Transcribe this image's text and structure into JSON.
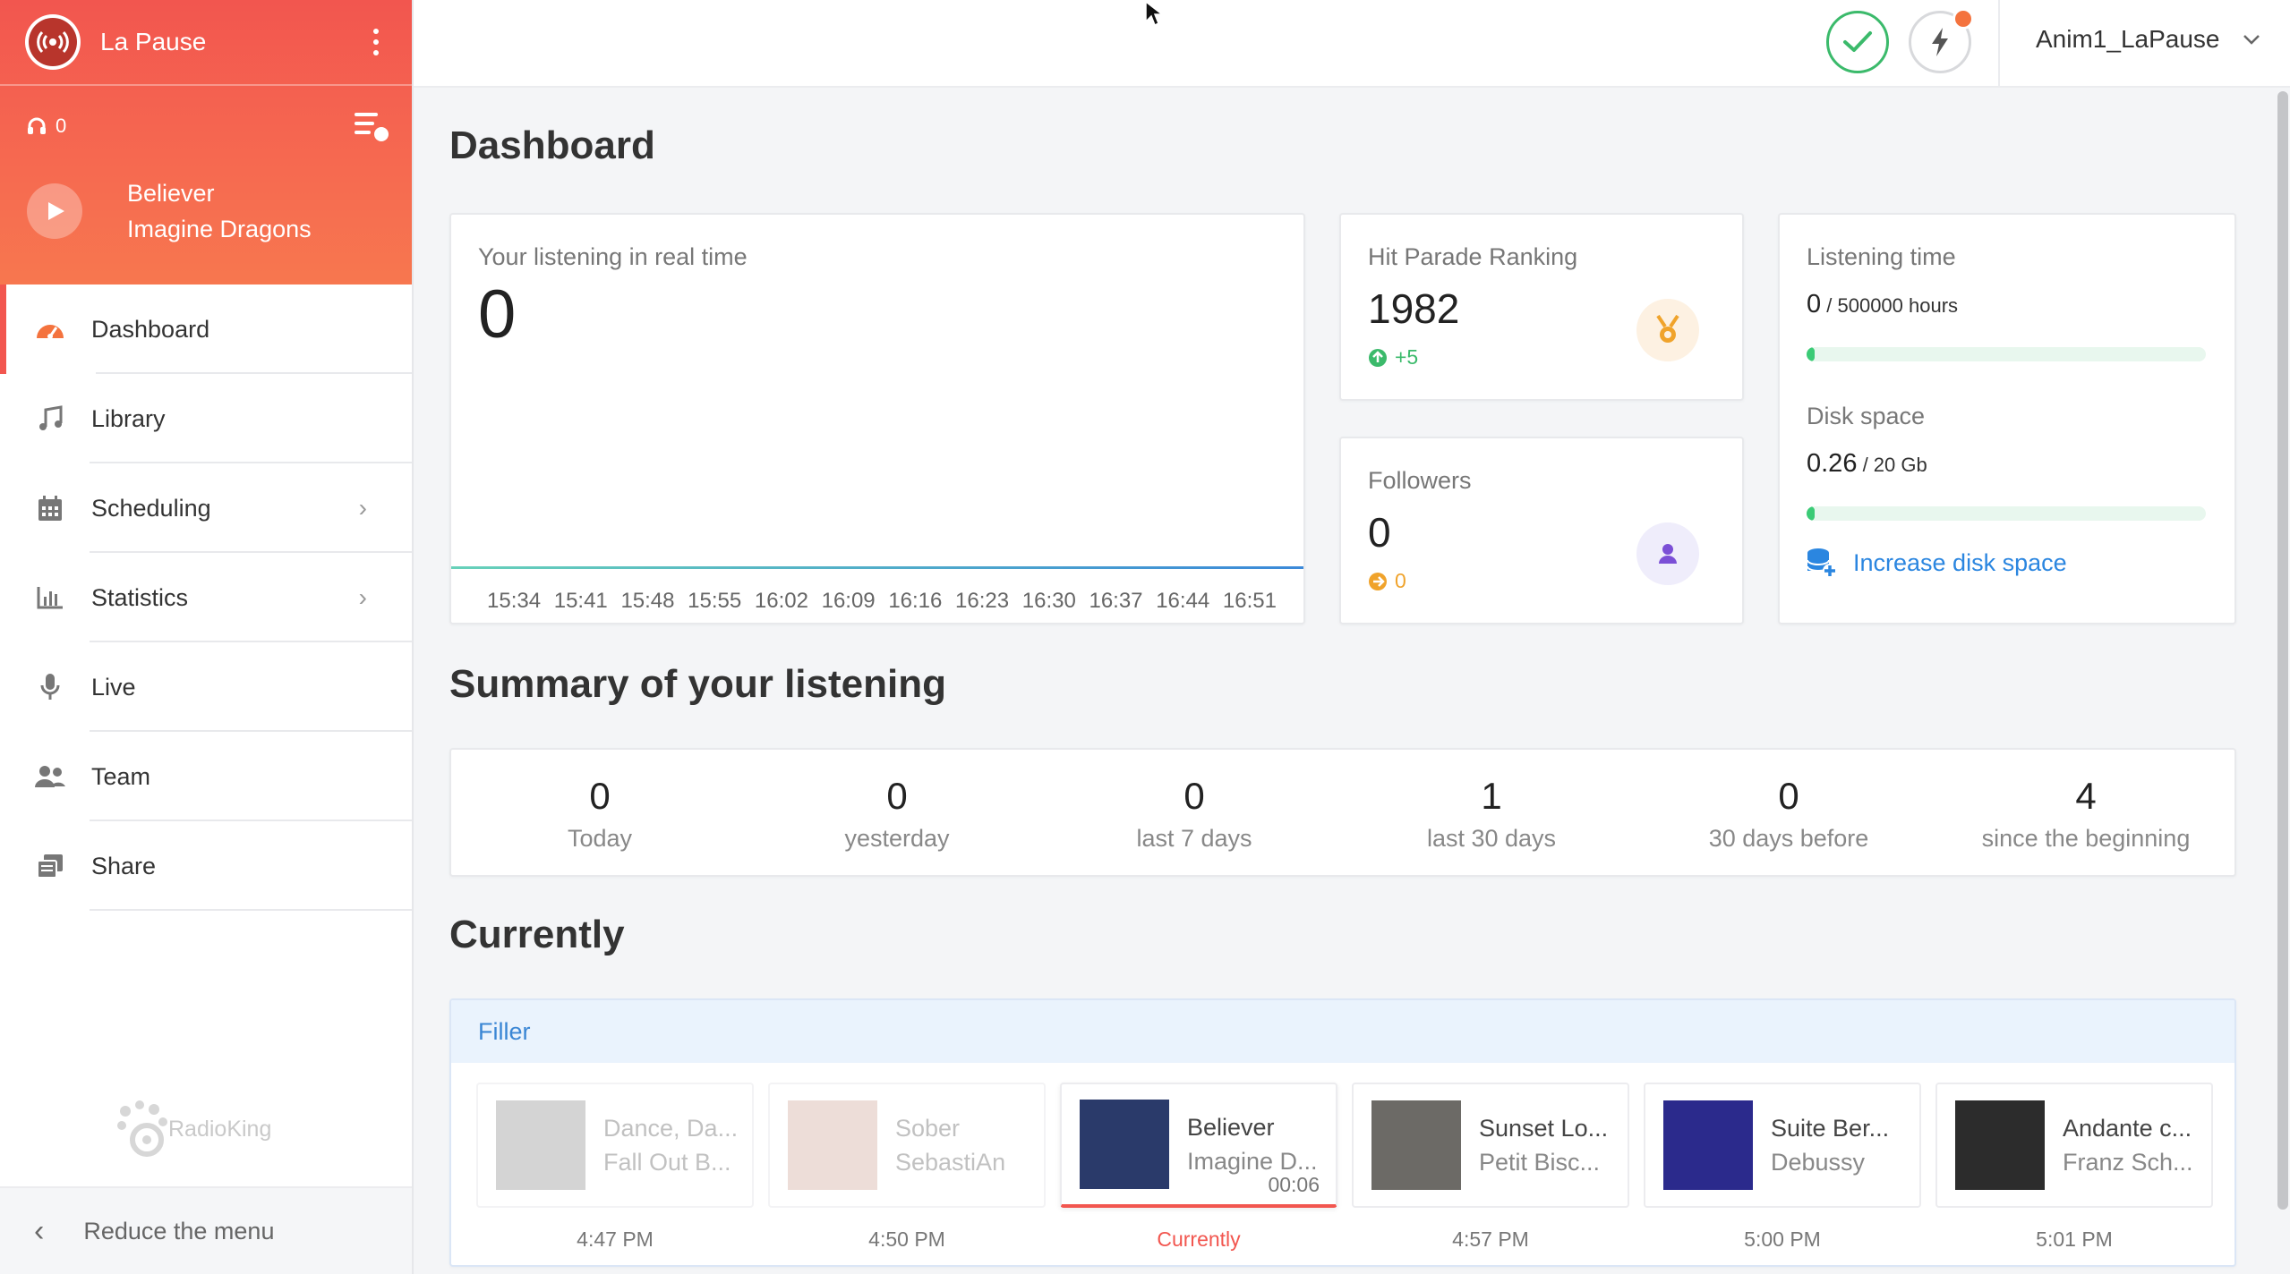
{
  "sidebar": {
    "station_name": "La Pause",
    "listeners": "0",
    "now_playing": {
      "title": "Believer",
      "artist": "Imagine Dragons"
    },
    "nav": [
      {
        "label": "Dashboard",
        "icon": "dashboard-icon",
        "active": true
      },
      {
        "label": "Library",
        "icon": "music-note-icon"
      },
      {
        "label": "Scheduling",
        "icon": "calendar-icon",
        "chevron": true
      },
      {
        "label": "Statistics",
        "icon": "bar-chart-icon",
        "chevron": true
      },
      {
        "label": "Live",
        "icon": "microphone-icon"
      },
      {
        "label": "Team",
        "icon": "team-icon"
      },
      {
        "label": "Share",
        "icon": "share-icon"
      }
    ],
    "brand": "RadioKing",
    "reduce_label": "Reduce the menu"
  },
  "header": {
    "username": "Anim1_LaPause"
  },
  "page_title": "Dashboard",
  "realtime": {
    "title": "Your listening in real time",
    "value": "0",
    "ticks": [
      "15:34",
      "15:41",
      "15:48",
      "15:55",
      "16:02",
      "16:09",
      "16:16",
      "16:23",
      "16:30",
      "16:37",
      "16:44",
      "16:51"
    ]
  },
  "hit_parade": {
    "title": "Hit Parade Ranking",
    "value": "1982",
    "delta": "+5"
  },
  "followers": {
    "title": "Followers",
    "value": "0",
    "delta": "0"
  },
  "listening_time": {
    "title": "Listening time",
    "value": "0",
    "unit": "/ 500000 hours",
    "fraction": 0.0
  },
  "disk_space": {
    "title": "Disk space",
    "value": "0.26",
    "unit": "/ 20 Gb",
    "fraction": 0.013,
    "increase_label": "Increase disk space"
  },
  "summary": {
    "title": "Summary of your listening",
    "items": [
      {
        "value": "0",
        "label": "Today"
      },
      {
        "value": "0",
        "label": "yesterday"
      },
      {
        "value": "0",
        "label": "last 7 days"
      },
      {
        "value": "1",
        "label": "last 30 days"
      },
      {
        "value": "0",
        "label": "30 days before"
      },
      {
        "value": "4",
        "label": "since the beginning"
      }
    ]
  },
  "currently": {
    "title": "Currently",
    "playlist": "Filler",
    "tracks": [
      {
        "title": "Dance, Da...",
        "artist": "Fall Out B...",
        "time": "4:47 PM",
        "state": "past",
        "cover": "#b9b9b9"
      },
      {
        "title": "Sober",
        "artist": "SebastiAn",
        "time": "4:50 PM",
        "state": "past",
        "cover": "#e2c8bf"
      },
      {
        "title": "Believer",
        "artist": "Imagine D...",
        "time": "Currently",
        "elapsed": "00:06",
        "state": "now",
        "cover": "#2a3a6a"
      },
      {
        "title": "Sunset Lo...",
        "artist": "Petit Bisc...",
        "time": "4:57 PM",
        "state": "next",
        "cover": "#6c6a66"
      },
      {
        "title": "Suite Ber...",
        "artist": "Debussy",
        "time": "5:00 PM",
        "state": "next",
        "cover": "#2b2a8c"
      },
      {
        "title": "Andante c...",
        "artist": "Franz Sch...",
        "time": "5:01 PM",
        "state": "next",
        "cover": "#2c2c2c"
      }
    ]
  },
  "colors": {
    "accent": "#f2564f",
    "success": "#3bba6b",
    "link": "#2b86e0",
    "warning": "#f0a32b"
  }
}
